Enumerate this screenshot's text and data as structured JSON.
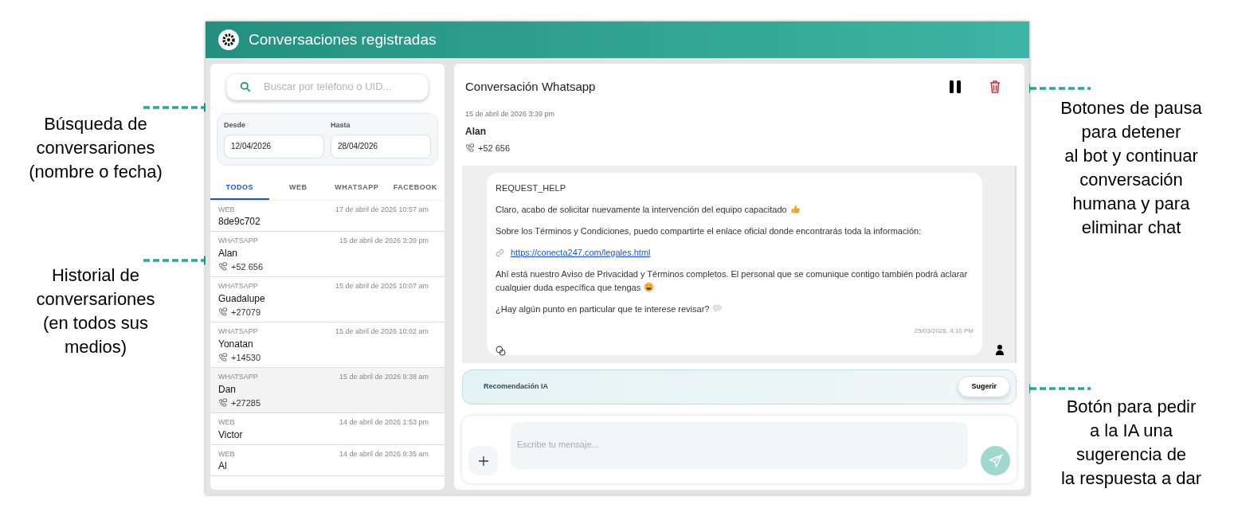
{
  "annotations": [
    {
      "lines": [
        "Búsqueda de",
        "conversariones",
        "(nombre o fecha)"
      ]
    },
    {
      "lines": [
        "Historial de",
        "conversariones",
        "(en todos sus",
        "medios)"
      ]
    },
    {
      "lines": [
        "Botones de pausa",
        "para detener",
        "al bot y continuar",
        "conversación",
        "humana y para",
        "eliminar chat"
      ]
    },
    {
      "lines": [
        "Botón para pedir",
        "a la IA una",
        "sugerencia de",
        "la respuesta a dar"
      ]
    }
  ],
  "header": {
    "title": "Conversaciones registradas"
  },
  "search": {
    "placeholder": "Buscar por teléfono o UID..."
  },
  "date_filter": [
    {
      "label": "Desde",
      "value": "12/04/2026"
    },
    {
      "label": "Hasta",
      "value": "28/04/2026"
    }
  ],
  "tabs": [
    {
      "label": "TODOS",
      "selected": true
    },
    {
      "label": "WEB",
      "selected": false
    },
    {
      "label": "WHATSAPP",
      "selected": false
    },
    {
      "label": "FACEBOOK",
      "selected": false
    }
  ],
  "conversations": [
    {
      "channel": "WEB",
      "time": "17 de abril de 2026 10:57 am",
      "name": "8de9c702",
      "highlighted": false
    },
    {
      "channel": "WHATSAPP",
      "time": "15 de abril de 2026 3:39 pm",
      "name": "Alan",
      "phone": "+52 656",
      "highlighted": false
    },
    {
      "channel": "WHATSAPP",
      "time": "15 de abril de 2026 10:07 am",
      "name": "Guadalupe",
      "phone": "+27079",
      "highlighted": false
    },
    {
      "channel": "WHATSAPP",
      "time": "15 de abril de 2026 10:02 am",
      "name": "Yonatan",
      "phone": "+14530",
      "highlighted": false
    },
    {
      "channel": "WHATSAPP",
      "time": "15 de abril de 2026 9:38 am",
      "name": "Dan",
      "phone": "+27285",
      "highlighted": true
    },
    {
      "channel": "WEB",
      "time": "14 de abril de 2026 1:53 pm",
      "name": "Victor",
      "highlighted": false
    },
    {
      "channel": "WEB",
      "time": "14 de abril de 2026 9:35 am",
      "name": "Al",
      "highlighted": false
    }
  ],
  "chat": {
    "title": "Conversación Whatsapp",
    "date": "15 de abril de 2026 3:39 pm",
    "name": "Alan",
    "phone": "+52 656",
    "message": {
      "tag": "REQUEST_HELP",
      "time": "25/03/2026, 4:10 PM",
      "paragraphs": [
        {
          "kind": "thanks",
          "text": "Claro, acabo de solicitar nuevamente la intervención del equipo capacitado"
        },
        {
          "kind": "plain",
          "text": "Sobre los Términos y Condiciones, puedo compartirte el enlace oficial donde encontrarás toda la información:"
        },
        {
          "kind": "link",
          "text": "https://conecta247.com/legales.html"
        },
        {
          "kind": "friendly",
          "text": "Ahí está nuestro Aviso de Privacidad y Términos completos. El personal que se comunique contigo también podrá aclarar cualquier duda específica que tengas"
        },
        {
          "kind": "question",
          "text": "¿Hay algún punto en particular que te interese revisar?"
        }
      ]
    }
  },
  "ai": {
    "label": "Recomendación IA",
    "button": "Sugerir"
  },
  "composer": {
    "placeholder": "Escribe tu mensaje..."
  }
}
